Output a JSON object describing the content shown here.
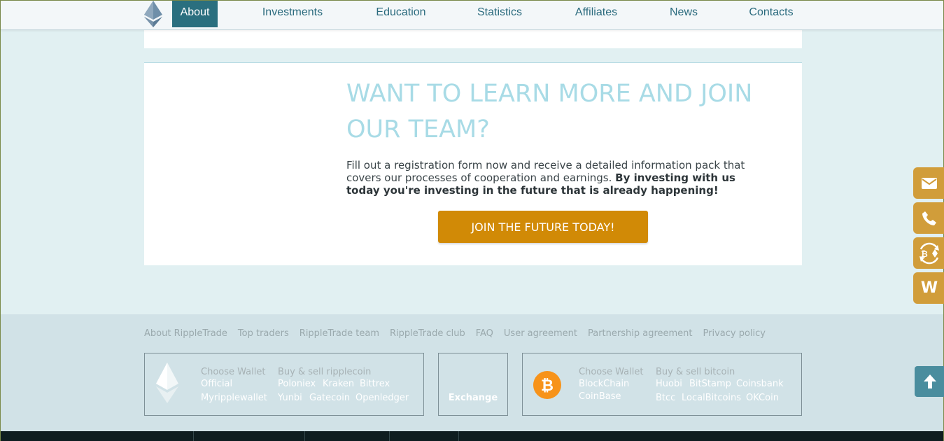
{
  "nav": {
    "items": [
      {
        "label": "About",
        "active": true
      },
      {
        "label": "Investments"
      },
      {
        "label": "Education"
      },
      {
        "label": "Statistics"
      },
      {
        "label": "Affiliates"
      },
      {
        "label": "News"
      },
      {
        "label": "Contacts"
      }
    ]
  },
  "promo": {
    "headline": "WANT TO LEARN MORE AND JOIN OUR TEAM?",
    "intro_text": "Fill out a registration form now and receive a detailed information pack that covers our processes of cooperation and earnings.",
    "intro_bold": "By investing with us today you're investing in the future that is already happening!",
    "cta_label": "JOIN THE FUTURE TODAY!"
  },
  "side_buttons": [
    {
      "icon": "email-icon"
    },
    {
      "icon": "phone-icon"
    },
    {
      "icon": "bitcoin-exchange-icon"
    },
    {
      "icon": "w-icon",
      "label": "W"
    }
  ],
  "footer": {
    "links": [
      "About RippleTrade",
      "Top traders",
      "RippleTrade team",
      "RippleTrade club",
      "FAQ",
      "User agreement",
      "Partnership agreement",
      "Privacy policy"
    ],
    "ripple_box": {
      "choose_wallet": "Choose Wallet",
      "wallets": [
        "Official",
        "Myripplewallet"
      ],
      "buy_sell": "Buy & sell ripplecoin",
      "exchanges_row1": [
        "Poloniex",
        "Kraken",
        "Bittrex"
      ],
      "exchanges_row2": [
        "Yunbi",
        "Gatecoin",
        "Openledger"
      ]
    },
    "exchange_box": {
      "label": "Exchange"
    },
    "bitcoin_box": {
      "choose_wallet": "Choose Wallet",
      "wallets": [
        "BlockChain",
        "CoinBase"
      ],
      "buy_sell": "Buy & sell bitcoin",
      "exchanges_row1": [
        "Huobi",
        "BitStamp",
        "Coinsbank"
      ],
      "exchanges_row2": [
        "Btcc",
        "LocalBitcoins",
        "OKCoin"
      ]
    }
  },
  "colors": {
    "accent": "#2a6f7f",
    "cta": "#d18a06",
    "side_button": "#d19d3a",
    "headline": "#a8dbe6"
  }
}
